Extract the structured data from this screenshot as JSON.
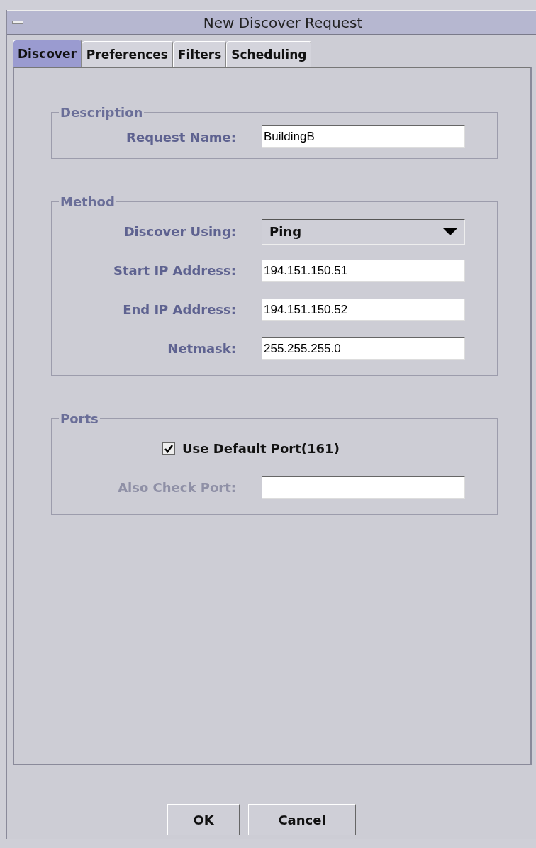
{
  "window": {
    "title": "New Discover Request"
  },
  "tabs": [
    {
      "label": "Discover",
      "selected": true
    },
    {
      "label": "Preferences",
      "selected": false
    },
    {
      "label": "Filters",
      "selected": false
    },
    {
      "label": "Scheduling",
      "selected": false
    }
  ],
  "groups": [
    {
      "title": "Description",
      "rows": [
        {
          "kind": "text",
          "label": "Request Name:",
          "value": "BuildingB",
          "disabled": false
        }
      ]
    },
    {
      "title": "Method",
      "rows": [
        {
          "kind": "dropdown",
          "label": "Discover Using:",
          "value": "Ping",
          "disabled": false
        },
        {
          "kind": "text",
          "label": "Start IP Address:",
          "value": "194.151.150.51",
          "disabled": false
        },
        {
          "kind": "text",
          "label": "End IP Address:",
          "value": "194.151.150.52",
          "disabled": false
        },
        {
          "kind": "text",
          "label": "Netmask:",
          "value": "255.255.255.0",
          "disabled": false
        }
      ]
    },
    {
      "title": "Ports",
      "rows": [
        {
          "kind": "checkbox",
          "label": "Use Default Port(161)",
          "checked": true
        },
        {
          "kind": "text",
          "label": "Also Check Port:",
          "disabled": true
        }
      ]
    }
  ],
  "buttons": [
    "OK",
    "Cancel"
  ]
}
